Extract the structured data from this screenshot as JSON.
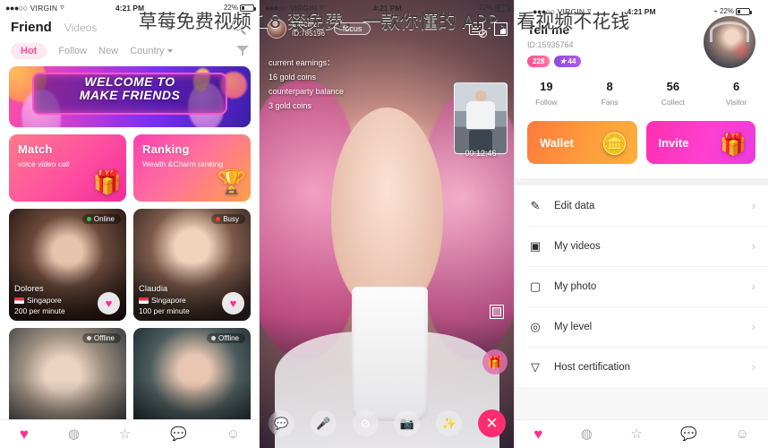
{
  "overlay": {
    "title": "草莓免费视频 18 禁免费，一款你懂的 APP，看视频不花钱"
  },
  "status_bar": {
    "carrier": "VIRGIN",
    "dots": "●●●○○",
    "wifi_icon": "wifi-icon",
    "time": "4:21 PM",
    "battery_percent": "22%",
    "bluetooth_icon": "bluetooth-icon"
  },
  "left_panel": {
    "header": {
      "tab_primary": "Friend",
      "tab_secondary": "Videos",
      "search_icon": "search-icon"
    },
    "filters": {
      "items": [
        {
          "label": "Hot",
          "active": true
        },
        {
          "label": "Follow",
          "active": false
        },
        {
          "label": "New",
          "active": false
        },
        {
          "label": "Country",
          "active": false,
          "has_caret": true
        }
      ],
      "filter_icon": "filter-icon"
    },
    "banner": {
      "line1": "WELCOME TO",
      "line2": "MAKE FRIENDS"
    },
    "tiles": [
      {
        "title": "Match",
        "subtitle": "voice video call",
        "art": "🎁"
      },
      {
        "title": "Ranking",
        "subtitle": "Wealth &Charm ranking",
        "art": "🏆"
      }
    ],
    "cards": [
      {
        "name": "Dolores",
        "country": "Singapore",
        "price": "200 per minute",
        "status": "Online",
        "status_color": "#2ecc40"
      },
      {
        "name": "Claudia",
        "country": "Singapore",
        "price": "100 per minute",
        "status": "Busy",
        "status_color": "#ff3b30"
      },
      {
        "name": "",
        "country": "",
        "price": "",
        "status": "Offline",
        "status_color": "#d9d9d9"
      },
      {
        "name": "",
        "country": "",
        "price": "",
        "status": "Offline",
        "status_color": "#d9d9d9"
      }
    ],
    "bottom_nav": [
      {
        "icon": "heart-icon",
        "glyph": "♥",
        "active": true
      },
      {
        "icon": "compass-icon",
        "glyph": "◍",
        "active": false
      },
      {
        "icon": "star-icon",
        "glyph": "☆",
        "active": false
      },
      {
        "icon": "message-icon",
        "glyph": "💬",
        "active": false
      },
      {
        "icon": "profile-icon",
        "glyph": "☺",
        "active": false
      }
    ]
  },
  "middle_panel": {
    "caller": {
      "name": "Cecilia",
      "id": "ID:785196",
      "focus_label": "focus",
      "avatar_icon": "avatar"
    },
    "top_icons": [
      {
        "icon": "block-message-icon"
      },
      {
        "icon": "minimize-icon"
      }
    ],
    "earnings": {
      "current_label": "current earnings：",
      "current_value": "16 gold coins",
      "counterparty_label": "counterparty balance",
      "counterparty_value": "3 gold coins"
    },
    "timer": "00:12:46",
    "gallery_icon": "gallery-icon",
    "gift_icon": "gift-icon",
    "controls": [
      {
        "icon": "chat-icon",
        "glyph": "💬"
      },
      {
        "icon": "mic-off-icon",
        "glyph": "🚫"
      },
      {
        "icon": "camera-off-icon",
        "glyph": "⊘"
      },
      {
        "icon": "camera-flip-icon",
        "glyph": "📷"
      },
      {
        "icon": "effects-icon",
        "glyph": "✨"
      },
      {
        "icon": "end-call-icon",
        "glyph": "✕"
      }
    ]
  },
  "right_panel": {
    "profile": {
      "name": "Tell me",
      "id": "ID:15935764",
      "avatar_icon": "avatar"
    },
    "badges": [
      {
        "label": "228",
        "type": "pink"
      },
      {
        "label": "44",
        "type": "purple",
        "icon": "star-icon"
      }
    ],
    "stats": [
      {
        "value": "19",
        "label": "Follow"
      },
      {
        "value": "8",
        "label": "Fans"
      },
      {
        "value": "56",
        "label": "Collect"
      },
      {
        "value": "6",
        "label": "Visitor"
      }
    ],
    "actions": [
      {
        "label": "Wallet",
        "art": "🪙"
      },
      {
        "label": "Invite",
        "art": "🎁"
      }
    ],
    "menu": [
      {
        "label": "Edit data",
        "icon": "pencil-icon",
        "glyph": "✎",
        "chevron": "›"
      },
      {
        "label": "My videos",
        "icon": "video-icon",
        "glyph": "▣",
        "chevron": "›"
      },
      {
        "label": "My photo",
        "icon": "photo-icon",
        "glyph": "▢",
        "chevron": "›"
      },
      {
        "label": "My level",
        "icon": "level-icon",
        "glyph": "◎",
        "chevron": "›"
      },
      {
        "label": "Host certification",
        "icon": "certification-icon",
        "glyph": "▽",
        "chevron": "›"
      }
    ],
    "bottom_nav": [
      {
        "icon": "heart-icon",
        "glyph": "♥",
        "active": true
      },
      {
        "icon": "compass-icon",
        "glyph": "◍",
        "active": false
      },
      {
        "icon": "star-icon",
        "glyph": "☆",
        "active": false
      },
      {
        "icon": "message-icon",
        "glyph": "💬",
        "active": false
      },
      {
        "icon": "profile-icon",
        "glyph": "☺",
        "active": false
      }
    ]
  },
  "colors": {
    "accent_pink": "#ff2f92",
    "wallet_orange": "#ff7a3d",
    "invite_magenta": "#ff2fb0"
  }
}
